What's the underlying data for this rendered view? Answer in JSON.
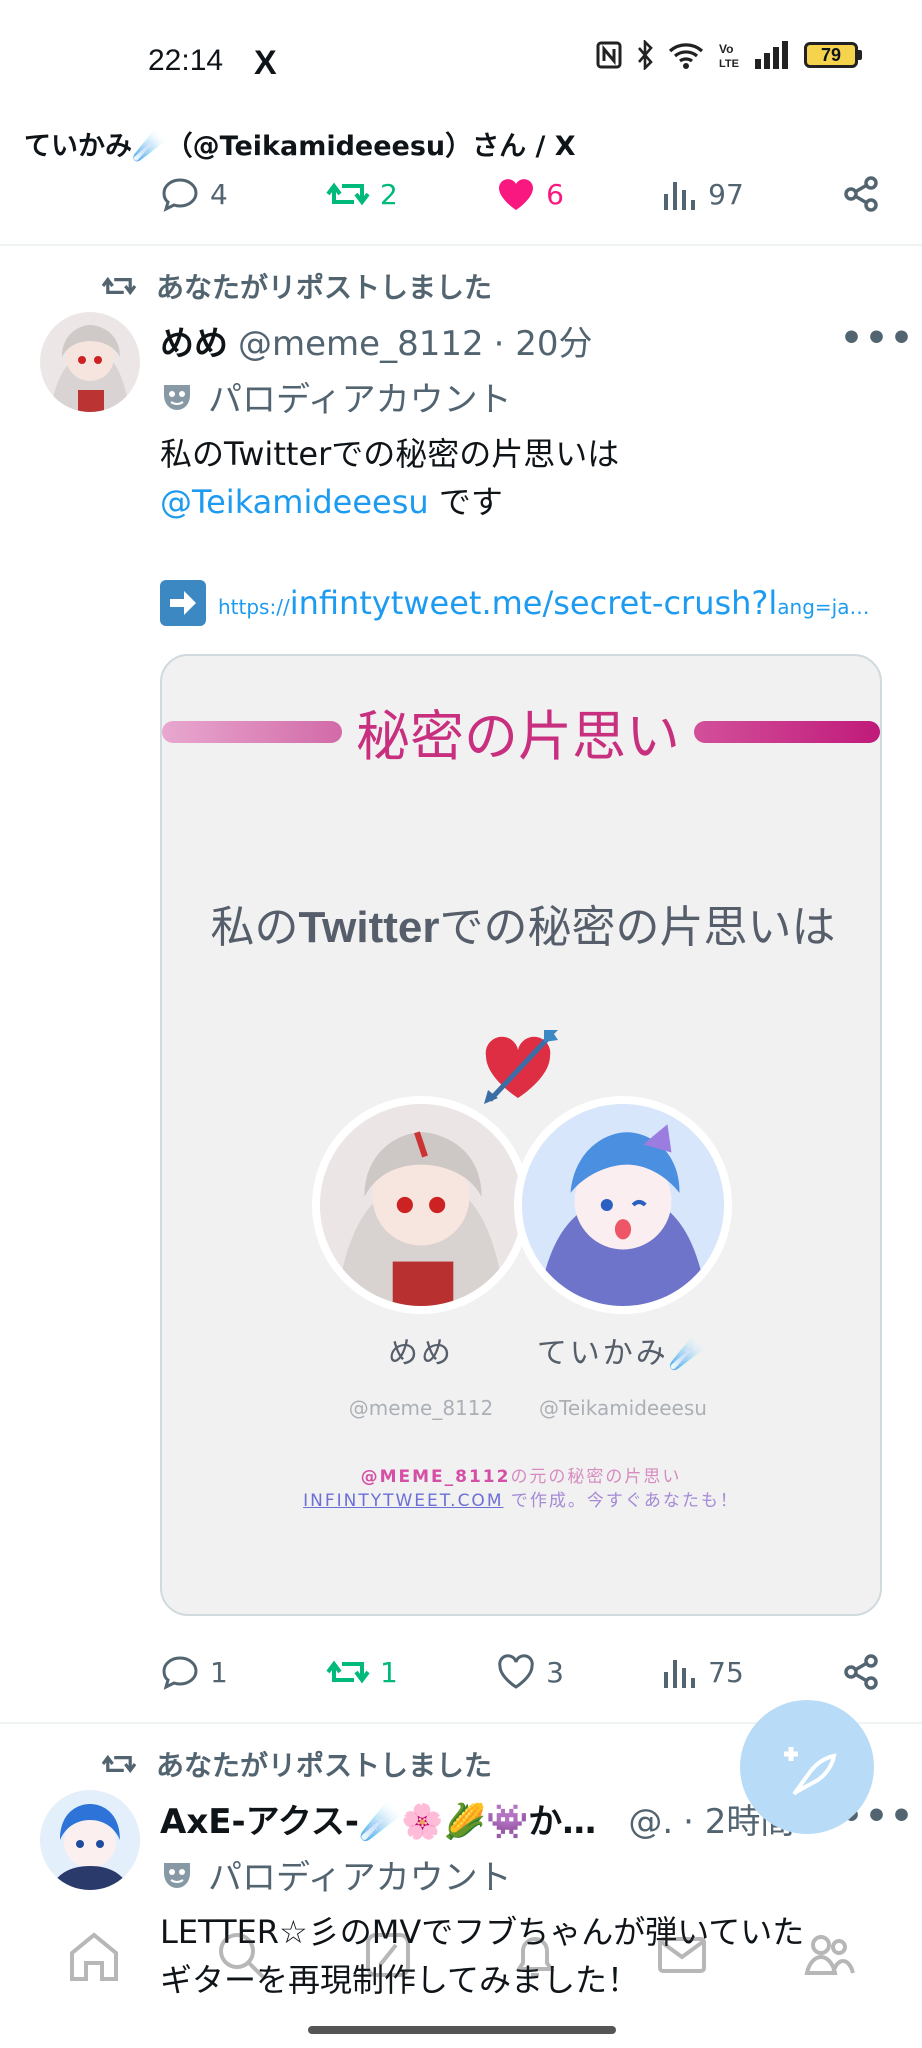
{
  "status": {
    "time": "22:14",
    "app_logo": "X",
    "battery": "79"
  },
  "page": {
    "title": "ていかみ☄️（@Teikamideeesu）さん / X"
  },
  "prev_actions": {
    "replies": "4",
    "reposts": "2",
    "likes": "6",
    "views": "97"
  },
  "tweet1": {
    "repost_label": "あなたがリポストしました",
    "name": "めめ",
    "handle": "@meme_8112",
    "time": "· 20分",
    "more": "•••",
    "parody_label": "パロディアカウント",
    "text_line1": "私のTwitterでの秘密の片思いは",
    "mention": "@Teikamideeesu",
    "text_line2_suffix": " です",
    "link_prefix": "https://",
    "link_main": "infintytweet.me/secret-crush?l",
    "link_tail": "ang=ja…",
    "card": {
      "title": "秘密の片思い",
      "message_pre": "私の",
      "message_brand": "Twitter",
      "message_post": "での秘密の片思いは",
      "left_name": "めめ",
      "left_handle": "@meme_8112",
      "right_name": "ていかみ☄️",
      "right_handle": "@Teikamideeesu",
      "footer_handle": "@MEME_8112",
      "footer_line1": "の元の秘密の片思い",
      "footer_site": "INFINTYTWEET.COM",
      "footer_line2": " で作成。今すぐあなたも！"
    },
    "actions": {
      "replies": "1",
      "reposts": "1",
      "likes": "3",
      "views": "75"
    }
  },
  "tweet2": {
    "repost_label": "あなたがリポストしました",
    "name": "AxE-アクス-☄️🌸🌽👾か…",
    "handle": "@.",
    "time": "· 2時間",
    "more": "•••",
    "parody_label": "パロディアカウント",
    "text_line1": "LETTER☆彡のMVでフブちゃんが弾いていた",
    "text_line2": "ギターを再現制作してみました！"
  },
  "colors": {
    "accent": "#1d9bf0",
    "repost": "#00ba7c",
    "like": "#f91880",
    "card_title": "#c8307f"
  }
}
